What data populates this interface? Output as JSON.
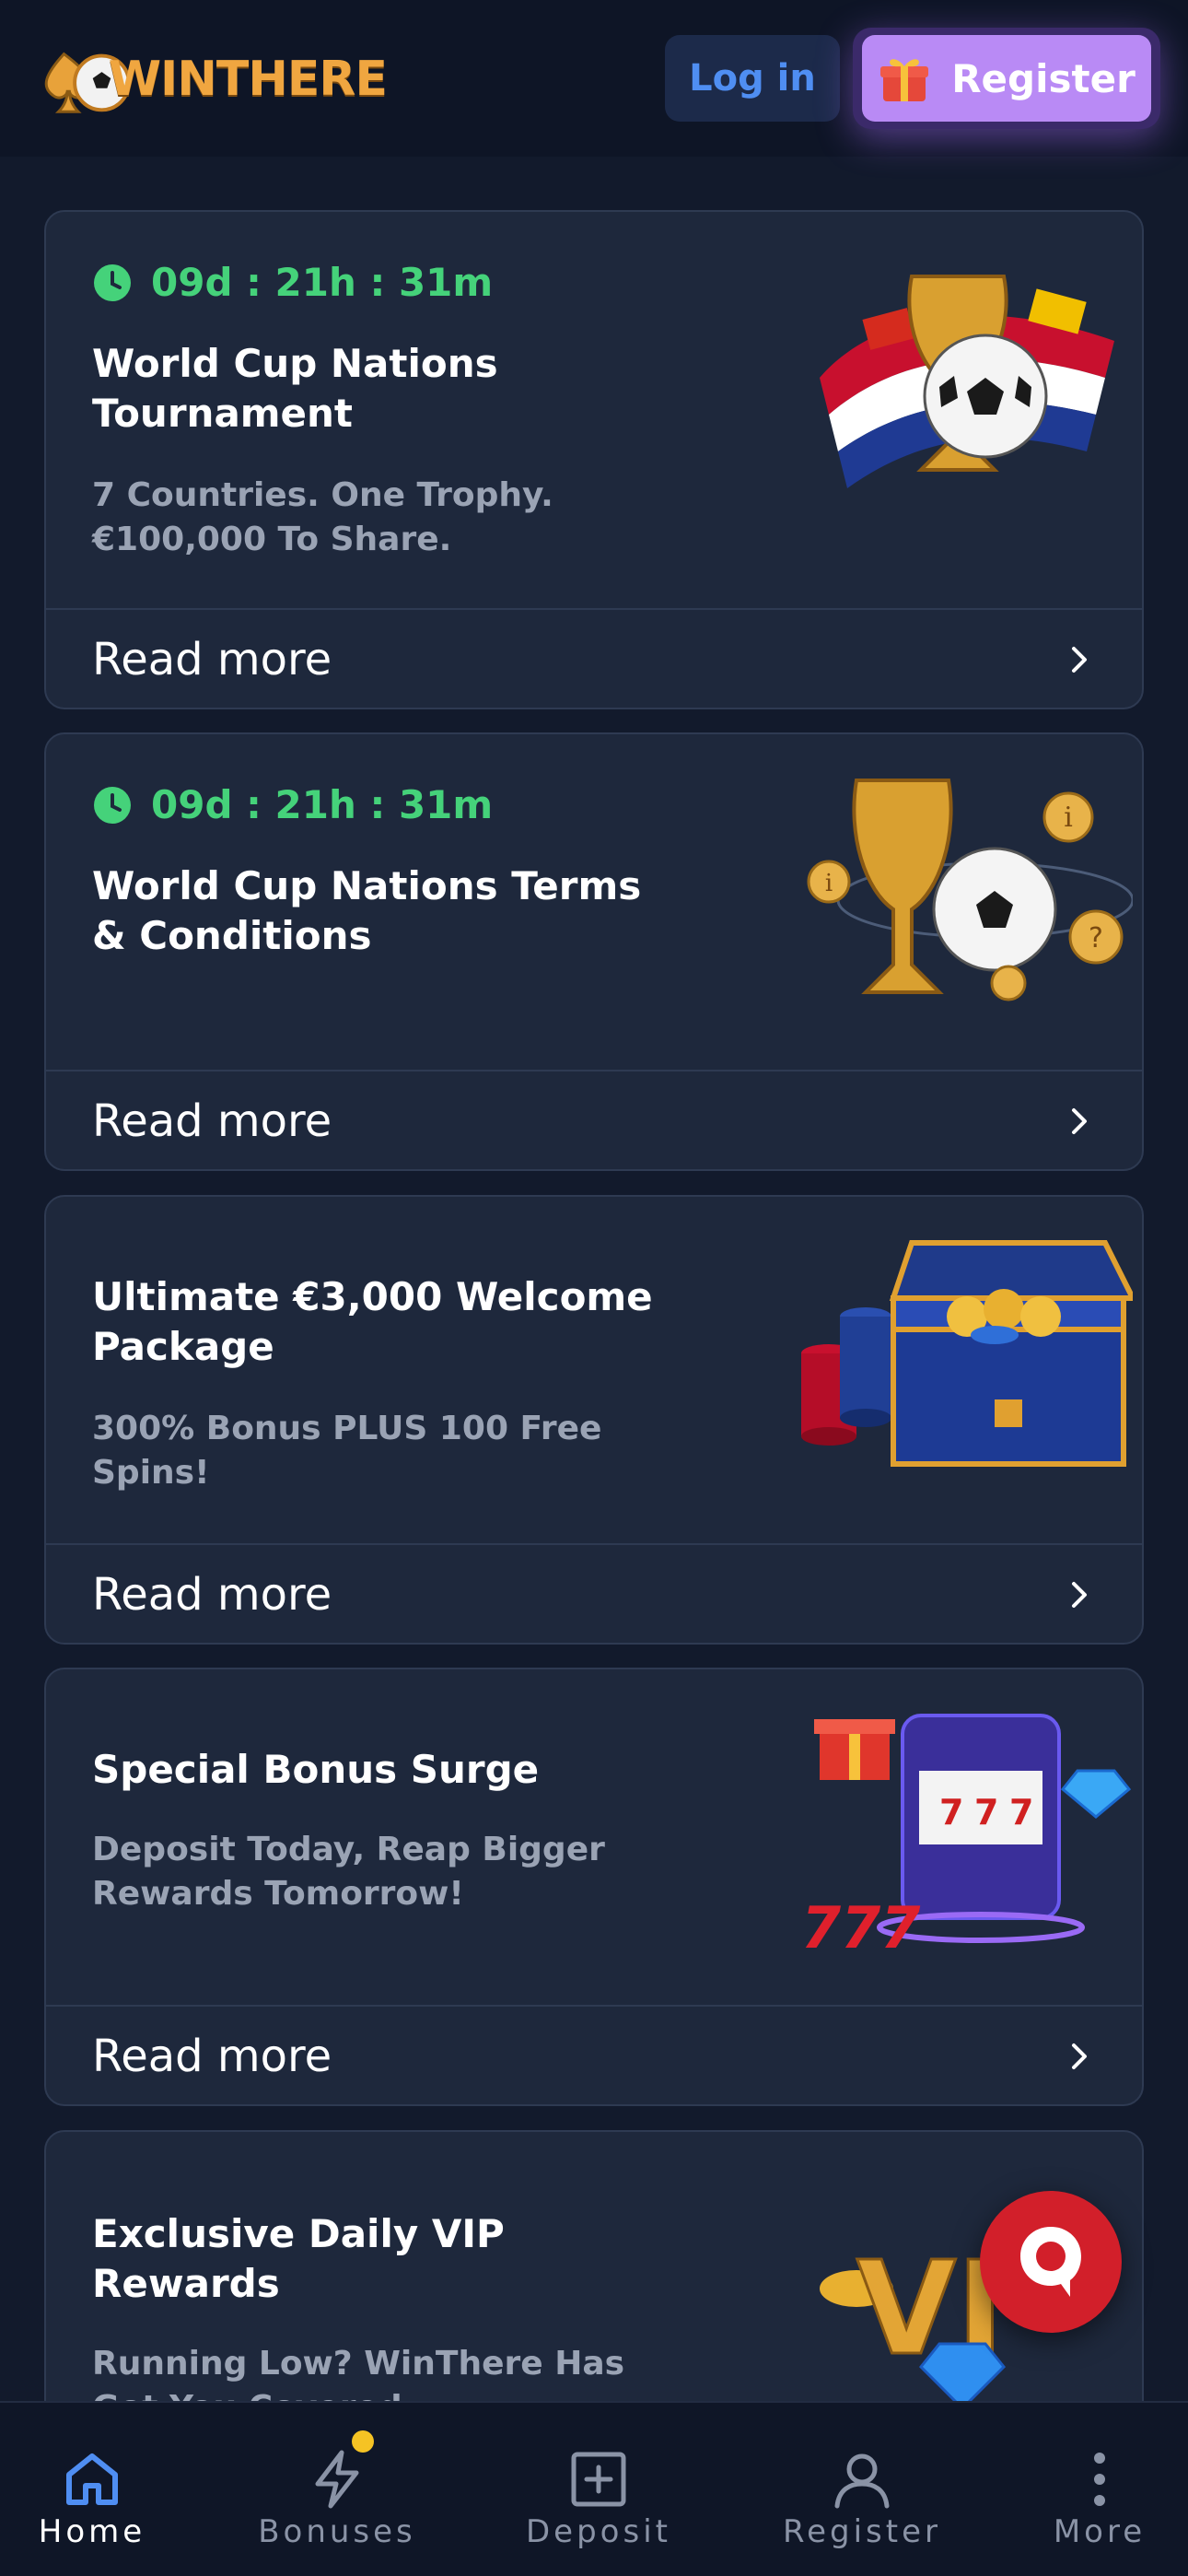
{
  "header": {
    "logo_text": "WINTHERE",
    "login_label": "Log in",
    "register_label": "Register"
  },
  "promotions": [
    {
      "timer": "09d : 21h : 31m",
      "title": "World Cup Nations Tournament",
      "description": "7 Countries. One Trophy. €100,000 To Share.",
      "cta": "Read more",
      "art": "trophy-flags-art"
    },
    {
      "timer": "09d : 21h : 31m",
      "title": "World Cup Nations Terms & Conditions",
      "description": "",
      "cta": "Read more",
      "art": "trophy-info-coins-art"
    },
    {
      "title": "Ultimate €3,000 Welcome Package",
      "description": "300% Bonus PLUS 100 Free Spins!",
      "cta": "Read more",
      "art": "treasure-chest-chips-art"
    },
    {
      "title": "Special Bonus Surge",
      "description": "Deposit Today, Reap Bigger Rewards Tomorrow!",
      "cta": "Read more",
      "art": "slot-machine-777-art"
    },
    {
      "title": "Exclusive Daily VIP Rewards",
      "description": "Running Low? WinThere Has Got You Covered",
      "art": "vip-diamond-art"
    }
  ],
  "bottom_nav": [
    {
      "label": "Home",
      "icon": "home-icon",
      "active": true
    },
    {
      "label": "Bonuses",
      "icon": "lightning-icon",
      "badge": true
    },
    {
      "label": "Deposit",
      "icon": "plus-square-icon"
    },
    {
      "label": "Register",
      "icon": "user-icon"
    },
    {
      "label": "More",
      "icon": "more-vertical-icon"
    }
  ],
  "colors": {
    "background": "#121a2c",
    "card": "#1e283c",
    "timer_green": "#45d27a",
    "accent_blue": "#4f8ef2",
    "register_purple": "#b98af5",
    "chat_red": "#d21f2a",
    "badge_yellow": "#f5c324"
  }
}
